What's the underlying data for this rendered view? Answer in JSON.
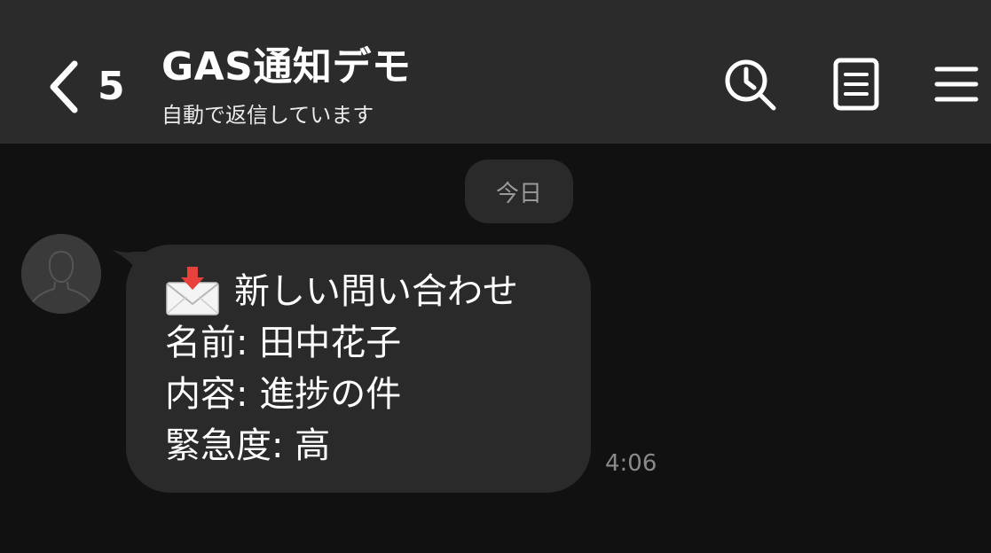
{
  "header": {
    "back_count": "5",
    "title": "GAS通知デモ",
    "subtitle": "自動で返信しています",
    "icons": [
      "chevron-left-icon",
      "search-history-icon",
      "note-icon",
      "menu-icon"
    ]
  },
  "chat": {
    "date_label": "今日",
    "message": {
      "sender_avatar": "default-user-icon",
      "emoji": "envelope-with-arrow-icon",
      "lines": [
        "新しい問い合わせ",
        "名前: 田中花子",
        "内容: 進捗の件",
        "緊急度: 高"
      ],
      "time": "4:06"
    }
  },
  "colors": {
    "header_bg": "#2b2b2b",
    "screen_bg": "#111111",
    "bubble_bg": "#2a2a2a",
    "muted_text": "#8a8a8a"
  }
}
